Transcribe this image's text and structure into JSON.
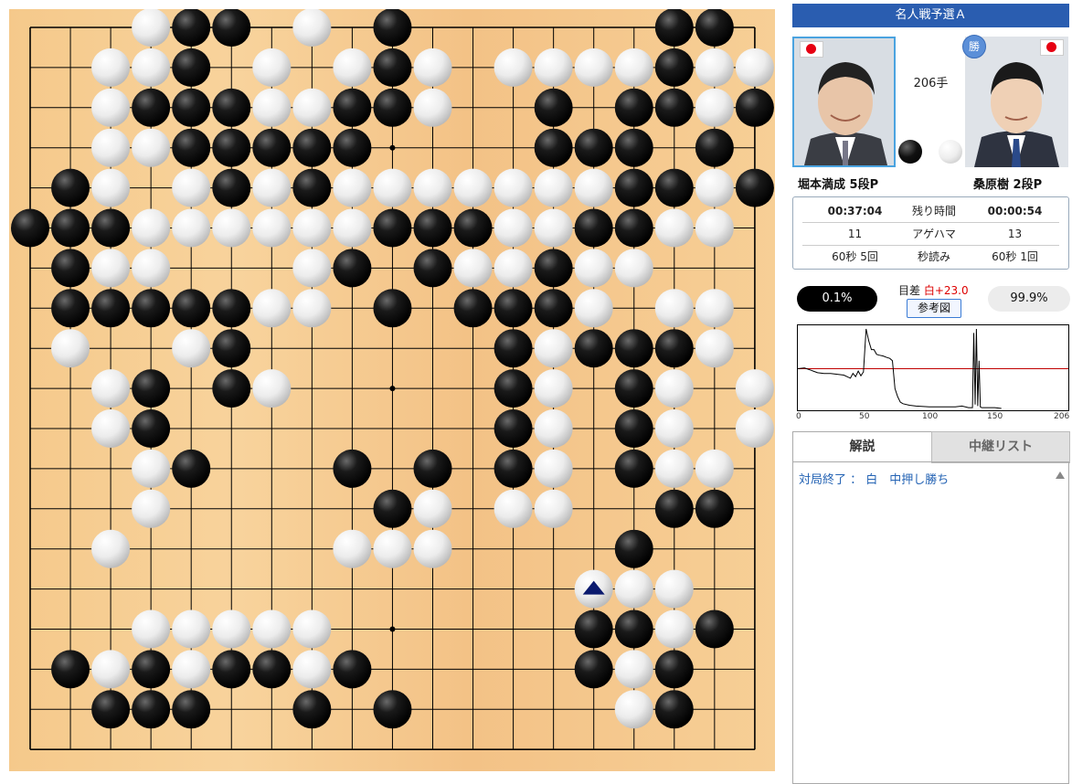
{
  "board": {
    "size": 19,
    "last_move_marker": "triangle-icon",
    "stones": {
      "black": [
        [
          4,
          0
        ],
        [
          5,
          0
        ],
        [
          9,
          0
        ],
        [
          16,
          0
        ],
        [
          17,
          0
        ],
        [
          4,
          1
        ],
        [
          9,
          1
        ],
        [
          16,
          1
        ],
        [
          3,
          2
        ],
        [
          4,
          2
        ],
        [
          5,
          2
        ],
        [
          8,
          2
        ],
        [
          9,
          2
        ],
        [
          13,
          2
        ],
        [
          15,
          2
        ],
        [
          16,
          2
        ],
        [
          18,
          2
        ],
        [
          4,
          3
        ],
        [
          5,
          3
        ],
        [
          6,
          3
        ],
        [
          7,
          3
        ],
        [
          8,
          3
        ],
        [
          13,
          3
        ],
        [
          14,
          3
        ],
        [
          15,
          3
        ],
        [
          17,
          3
        ],
        [
          1,
          4
        ],
        [
          5,
          4
        ],
        [
          7,
          4
        ],
        [
          15,
          4
        ],
        [
          16,
          4
        ],
        [
          18,
          4
        ],
        [
          0,
          5
        ],
        [
          1,
          5
        ],
        [
          2,
          5
        ],
        [
          9,
          5
        ],
        [
          10,
          5
        ],
        [
          11,
          5
        ],
        [
          14,
          5
        ],
        [
          15,
          5
        ],
        [
          1,
          6
        ],
        [
          8,
          6
        ],
        [
          10,
          6
        ],
        [
          13,
          6
        ],
        [
          1,
          7
        ],
        [
          2,
          7
        ],
        [
          3,
          7
        ],
        [
          4,
          7
        ],
        [
          5,
          7
        ],
        [
          9,
          7
        ],
        [
          11,
          7
        ],
        [
          12,
          7
        ],
        [
          13,
          7
        ],
        [
          5,
          8
        ],
        [
          12,
          8
        ],
        [
          14,
          8
        ],
        [
          15,
          8
        ],
        [
          16,
          8
        ],
        [
          3,
          9
        ],
        [
          5,
          9
        ],
        [
          12,
          9
        ],
        [
          15,
          9
        ],
        [
          3,
          10
        ],
        [
          12,
          10
        ],
        [
          15,
          10
        ],
        [
          4,
          11
        ],
        [
          8,
          11
        ],
        [
          10,
          11
        ],
        [
          12,
          11
        ],
        [
          15,
          11
        ],
        [
          9,
          12
        ],
        [
          16,
          12
        ],
        [
          17,
          12
        ],
        [
          15,
          13
        ],
        [
          14,
          15
        ],
        [
          15,
          15
        ],
        [
          17,
          15
        ],
        [
          1,
          16
        ],
        [
          3,
          16
        ],
        [
          5,
          16
        ],
        [
          6,
          16
        ],
        [
          8,
          16
        ],
        [
          14,
          16
        ],
        [
          16,
          16
        ],
        [
          2,
          17
        ],
        [
          3,
          17
        ],
        [
          4,
          17
        ],
        [
          7,
          17
        ],
        [
          9,
          17
        ],
        [
          16,
          17
        ]
      ],
      "white": [
        [
          3,
          0
        ],
        [
          7,
          0
        ],
        [
          2,
          1
        ],
        [
          3,
          1
        ],
        [
          6,
          1
        ],
        [
          8,
          1
        ],
        [
          10,
          1
        ],
        [
          12,
          1
        ],
        [
          13,
          1
        ],
        [
          14,
          1
        ],
        [
          15,
          1
        ],
        [
          17,
          1
        ],
        [
          18,
          1
        ],
        [
          2,
          2
        ],
        [
          6,
          2
        ],
        [
          7,
          2
        ],
        [
          10,
          2
        ],
        [
          17,
          2
        ],
        [
          2,
          3
        ],
        [
          3,
          3
        ],
        [
          2,
          4
        ],
        [
          4,
          4
        ],
        [
          6,
          4
        ],
        [
          8,
          4
        ],
        [
          9,
          4
        ],
        [
          10,
          4
        ],
        [
          11,
          4
        ],
        [
          12,
          4
        ],
        [
          13,
          4
        ],
        [
          14,
          4
        ],
        [
          17,
          4
        ],
        [
          3,
          5
        ],
        [
          4,
          5
        ],
        [
          5,
          5
        ],
        [
          6,
          5
        ],
        [
          7,
          5
        ],
        [
          8,
          5
        ],
        [
          12,
          5
        ],
        [
          13,
          5
        ],
        [
          16,
          5
        ],
        [
          17,
          5
        ],
        [
          2,
          6
        ],
        [
          3,
          6
        ],
        [
          7,
          6
        ],
        [
          11,
          6
        ],
        [
          12,
          6
        ],
        [
          14,
          6
        ],
        [
          15,
          6
        ],
        [
          6,
          7
        ],
        [
          7,
          7
        ],
        [
          14,
          7
        ],
        [
          16,
          7
        ],
        [
          17,
          7
        ],
        [
          1,
          8
        ],
        [
          4,
          8
        ],
        [
          13,
          8
        ],
        [
          17,
          8
        ],
        [
          2,
          9
        ],
        [
          6,
          9
        ],
        [
          13,
          9
        ],
        [
          16,
          9
        ],
        [
          18,
          9
        ],
        [
          2,
          10
        ],
        [
          13,
          10
        ],
        [
          16,
          10
        ],
        [
          18,
          10
        ],
        [
          3,
          11
        ],
        [
          13,
          11
        ],
        [
          16,
          11
        ],
        [
          17,
          11
        ],
        [
          3,
          12
        ],
        [
          10,
          12
        ],
        [
          12,
          12
        ],
        [
          13,
          12
        ],
        [
          2,
          13
        ],
        [
          8,
          13
        ],
        [
          9,
          13
        ],
        [
          10,
          13
        ],
        [
          14,
          14
        ],
        [
          15,
          14
        ],
        [
          16,
          14
        ],
        [
          3,
          15
        ],
        [
          4,
          15
        ],
        [
          5,
          15
        ],
        [
          6,
          15
        ],
        [
          7,
          15
        ],
        [
          16,
          15
        ],
        [
          2,
          16
        ],
        [
          4,
          16
        ],
        [
          7,
          16
        ],
        [
          15,
          16
        ],
        [
          15,
          17
        ]
      ]
    },
    "last_move": [
      14,
      14
    ]
  },
  "panel": {
    "title": "名人戦予選Ａ",
    "move_count": "206手",
    "black_player": "堀本満成 5段P",
    "white_player": "桑原樹 2段P",
    "winner_badge": "勝",
    "black_time": "00:37:04",
    "white_time": "00:00:54",
    "time_label": "残り時間",
    "black_captures": "11",
    "white_captures": "13",
    "captures_label": "アゲハマ",
    "black_byoyomi": "60秒 5回",
    "white_byoyomi": "60秒 1回",
    "byoyomi_label": "秒読み",
    "black_winrate": "0.1%",
    "white_winrate": "99.9%",
    "score_label": "目差",
    "score_value": "白+23.0",
    "reference_button": "参考図",
    "graph_ticks": [
      "0",
      "50",
      "100",
      "150",
      "206"
    ],
    "tab_commentary": "解説",
    "tab_relay": "中継リスト",
    "comment": "対局終了 ： 白　中押し勝ち"
  },
  "colors": {
    "title_bar": "#2a5db0",
    "board": "#f5c98b",
    "winrate_line": "#c00000",
    "comment_text": "#2463b4"
  },
  "chart_data": {
    "type": "line",
    "x": [
      0,
      5,
      10,
      15,
      20,
      25,
      30,
      35,
      40,
      42,
      44,
      46,
      48,
      50,
      52,
      54,
      56,
      58,
      60,
      62,
      65,
      68,
      70,
      72,
      74,
      76,
      78,
      80,
      85,
      90,
      100,
      110,
      120,
      125,
      130,
      133,
      134,
      135,
      136,
      137,
      138,
      139,
      140,
      145,
      150,
      155
    ],
    "values": [
      50,
      51,
      48,
      45,
      44,
      44,
      43,
      42,
      38,
      44,
      40,
      47,
      41,
      46,
      100,
      85,
      74,
      74,
      68,
      67,
      66,
      64,
      63,
      60,
      25,
      15,
      8,
      6,
      4,
      3,
      2,
      2,
      2,
      3,
      1,
      1,
      95,
      5,
      100,
      3,
      60,
      2,
      1,
      1,
      1,
      0
    ],
    "xlim": [
      0,
      206
    ],
    "ylim": [
      0,
      100
    ],
    "reference_line": 50,
    "tick_labels": [
      "0",
      "50",
      "100",
      "150",
      "206"
    ]
  }
}
